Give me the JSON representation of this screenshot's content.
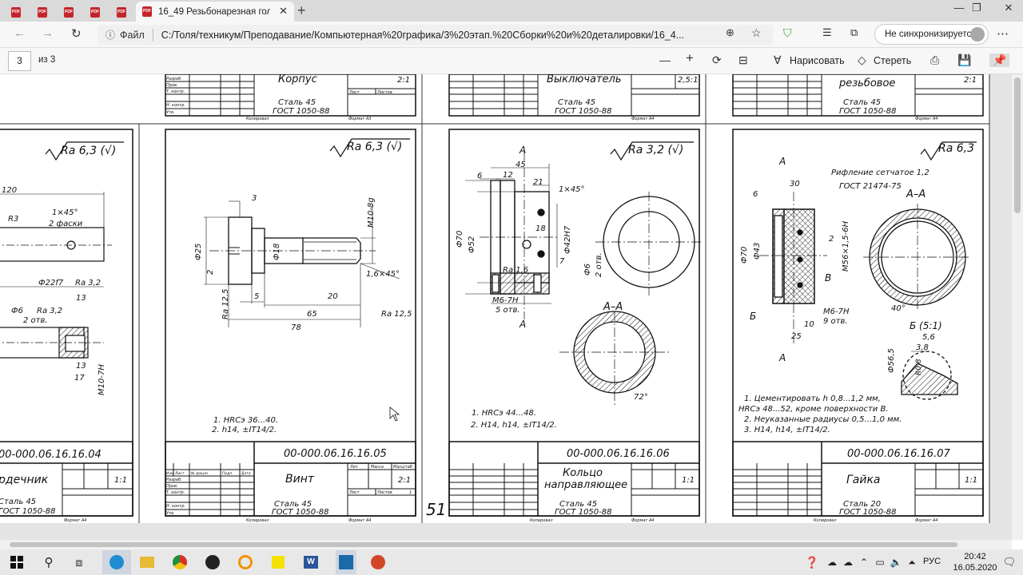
{
  "browser": {
    "active_tab_title": "16_49 Резьбонарезная головка",
    "address_prefix": "Файл",
    "url": "C:/Толя/техникум/Преподавание/Компьютерная%20графика/3%20этап.%20Сборки%20и%20деталировки/16_4...",
    "sync_label": "Не синхронизируется",
    "pdf_tab_icon": "PDF"
  },
  "pdf_toolbar": {
    "page_current": "3",
    "page_total": "из 3",
    "draw_label": "Нарисовать",
    "erase_label": "Стереть"
  },
  "drawings": {
    "top_row": [
      {
        "name": "Корпус",
        "material": "Сталь 45",
        "gost": "ГОСТ 1050-88",
        "scale": "2:1",
        "format": "Формат А3"
      },
      {
        "name": "Выключатель",
        "material": "Сталь 45",
        "gost": "ГОСТ 1050-88",
        "scale": "2,5:1",
        "format": "Формат А4"
      },
      {
        "name": "резьбовое",
        "material": "Сталь 45",
        "gost": "ГОСТ 1050-88",
        "scale": "2:1",
        "format": "Формат А4"
      }
    ],
    "sheet_partial": {
      "number": "00-000.06.16.16.04",
      "name": "рдечник",
      "material": "Сталь 45",
      "gost": "ГОСТ 1050-88",
      "scale": "1:1",
      "roughness": "Ra 6,3 (√)",
      "labels": [
        "120",
        "R3",
        "1×45°",
        "2 фаски",
        "Ф22f7",
        "Ra 3,2",
        "Ф6",
        "Ra 3,2",
        "2 отв.",
        "13",
        "13",
        "17",
        "M10-7H"
      ]
    },
    "sheet_vint": {
      "number": "00-000.06.16.16.05",
      "name": "Винт",
      "material": "Сталь 45",
      "gost": "ГОСТ 1050-88",
      "scale": "2:1",
      "roughness": "Ra 6,3 (√)",
      "notes": [
        "1. HRCэ 36...40.",
        "2. h14, ±IT14/2."
      ],
      "labels": [
        "3",
        "Ф25",
        "2",
        "Ф18",
        "M10-8g",
        "1,6×45°",
        "5",
        "20",
        "65",
        "78",
        "Ra 12,5",
        "Ra 12,5"
      ]
    },
    "sheet_kolco": {
      "number": "00-000.06.16.16.06",
      "name_line1": "Кольцо",
      "name_line2": "направляющее",
      "material": "Сталь 45",
      "gost": "ГОСТ 1050-88",
      "scale": "1:1",
      "roughness": "Ra 3,2 (√)",
      "page_number": "51",
      "notes": [
        "1. HRCэ 44...48.",
        "2. H14, h14, ±IT14/2."
      ],
      "labels": [
        "A",
        "45",
        "6",
        "12",
        "21",
        "1×45°",
        "Ф70",
        "Ф52",
        "Ф42H7",
        "18",
        "Ra 1,6",
        "7",
        "Ф6",
        "2 отв.",
        "M6-7H",
        "5 отв.",
        "A",
        "A–A",
        "72°"
      ]
    },
    "sheet_gaika": {
      "number": "00-000.06.16.16.07",
      "name": "Гайка",
      "material": "Сталь 20",
      "gost": "ГОСТ 1050-88",
      "scale": "1:1",
      "roughness": "Ra 6,3",
      "notes": [
        "1. Цементировать h 0,8...1,2 мм,",
        "HRCэ 48...52, кроме поверхности В.",
        "2. Неуказанные радиусы 0,5...1,0 мм.",
        "3. H14, h14, ±IT14/2."
      ],
      "labels": [
        "A",
        "30",
        "Рифление сетчатое 1,2",
        "ГОСТ 21474-75",
        "6",
        "A–A",
        "Ф70",
        "Ф43",
        "2",
        "M56×1,5-6H",
        "B",
        "Б",
        "M6-7H",
        "9 отв.",
        "40°",
        "10",
        "25",
        "A",
        "Б (5:1)",
        "5,6",
        "3,8",
        "Ф56,5",
        "R0,8"
      ]
    },
    "stamp_labels": {
      "razrab": "Разраб.",
      "prov": "Пров.",
      "tkontr": "Т. контр.",
      "nkontr": "Н. контр.",
      "utv": "Утв.",
      "lit": "Лит",
      "massa": "Масса",
      "masshtab": "Масштаб",
      "list": "Лист",
      "listov": "Листов",
      "izm": "Изм",
      "list2": "Лист",
      "ndokum": "№ докум.",
      "podp": "Подп.",
      "data": "Дата",
      "kopiroval": "Копировал",
      "format_a4": "Формат А4",
      "one": "1"
    }
  },
  "taskbar": {
    "time": "20:42",
    "date": "16.05.2020",
    "lang": "РУС"
  }
}
